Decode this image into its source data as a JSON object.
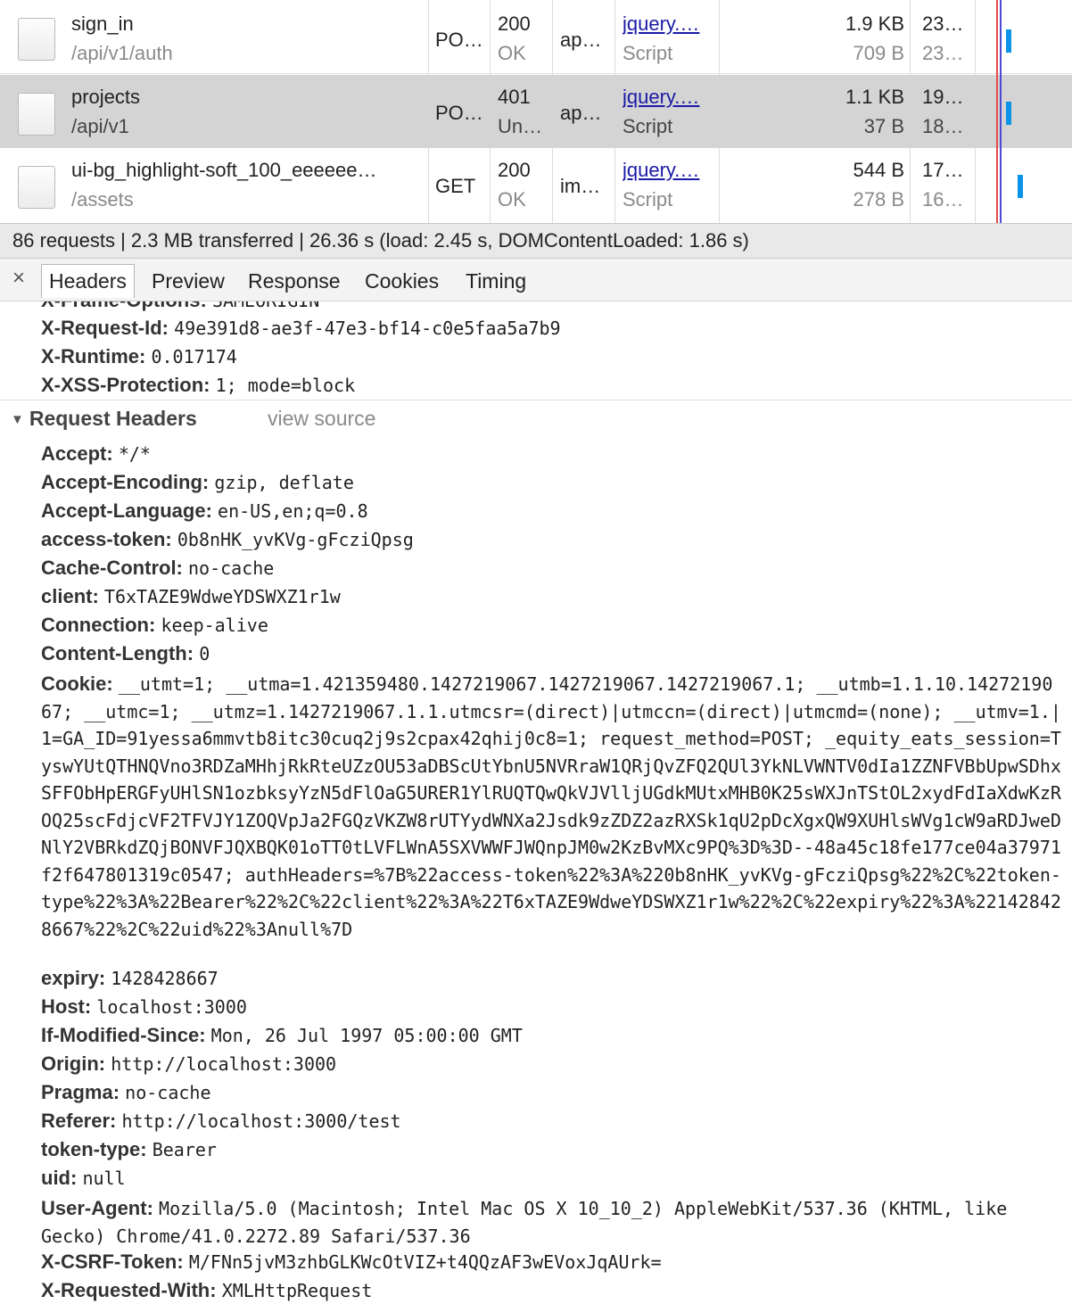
{
  "requests": [
    {
      "name": "sign_in",
      "path": "/api/v1/auth",
      "method": "PO…",
      "status": "200",
      "status_text": "OK",
      "type": "ap…",
      "initiator": "jquery.…",
      "initiator_type": "Script",
      "size": "1.9 KB",
      "content": "709 B",
      "time": "23…",
      "latency": "23…",
      "selected": false
    },
    {
      "name": "projects",
      "path": "/api/v1",
      "method": "PO…",
      "status": "401",
      "status_text": "Un…",
      "type": "ap…",
      "initiator": "jquery.…",
      "initiator_type": "Script",
      "size": "1.1 KB",
      "content": "37 B",
      "time": "19…",
      "latency": "18…",
      "selected": true
    },
    {
      "name": "ui-bg_highlight-soft_100_eeeeee…",
      "path": "/assets",
      "method": "GET",
      "status": "200",
      "status_text": "OK",
      "type": "im…",
      "initiator": "jquery.…",
      "initiator_type": "Script",
      "size": "544 B",
      "content": "278 B",
      "time": "17…",
      "latency": "16…",
      "selected": false
    }
  ],
  "status_bar": "86 requests | 2.3 MB transferred | 26.36 s (load: 2.45 s, DOMContentLoaded: 1.86 s)",
  "tabs": {
    "close": "×",
    "items": [
      "Headers",
      "Preview",
      "Response",
      "Cookies",
      "Timing"
    ],
    "active": "Headers"
  },
  "response_headers_tail": [
    {
      "k": "X-Frame-Options:",
      "v": "SAMEORIGIN"
    },
    {
      "k": "X-Request-Id:",
      "v": "49e391d8-ae3f-47e3-bf14-c0e5faa5a7b9"
    },
    {
      "k": "X-Runtime:",
      "v": "0.017174"
    },
    {
      "k": "X-XSS-Protection:",
      "v": "1; mode=block"
    }
  ],
  "request_section": {
    "title": "Request Headers",
    "view_source": "view source"
  },
  "request_headers_a": [
    {
      "k": "Accept:",
      "v": "*/*"
    },
    {
      "k": "Accept-Encoding:",
      "v": "gzip, deflate"
    },
    {
      "k": "Accept-Language:",
      "v": "en-US,en;q=0.8"
    },
    {
      "k": "access-token:",
      "v": "0b8nHK_yvKVg-gFcziQpsg"
    },
    {
      "k": "Cache-Control:",
      "v": "no-cache"
    },
    {
      "k": "client:",
      "v": "T6xTAZE9WdweYDSWXZ1r1w"
    },
    {
      "k": "Connection:",
      "v": "keep-alive"
    },
    {
      "k": "Content-Length:",
      "v": "0"
    }
  ],
  "cookie": {
    "k": "Cookie:",
    "v": "__utmt=1; __utma=1.421359480.1427219067.1427219067.1427219067.1; __utmb=1.1.10.1427219067; __utmc=1; __utmz=1.1427219067.1.1.utmcsr=(direct)|utmccn=(direct)|utmcmd=(none); __utmv=1.|1=GA_ID=91yessa6mmvtb8itc30cuq2j9s2cpax42qhij0c8=1; request_method=POST; _equity_eats_session=TyswYUtQTHNQVno3RDZaMHhjRkRteUZzOU53aDBScUtYbnU5NVRraW1QRjQvZFQ2QUl3YkNLVWNTV0dIa1ZZNFVBbUpwSDhxSFFObHpERGFyUHlSN1ozbksyYzN5dFlOaG5URER1YlRUQTQwQkVJVlljUGdkMUtxMHB0K25sWXJnTStOL2xydFdIaXdwKzROQ25scFdjcVF2TFVJY1ZOQVpJa2FGQzVKZW8rUTYydWNXa2Jsdk9zZDZ2azRXSk1qU2pDcXgxQW9XUHlsWVg1cW9aRDJweDNlY2VBRkdZQjBONVFJQXBQK01oTT0tLVFLWnA5SXVWWFJWQnpJM0w2KzBvMXc9PQ%3D%3D--48a45c18fe177ce04a37971f2f647801319c0547; authHeaders=%7B%22access-token%22%3A%220b8nHK_yvKVg-gFcziQpsg%22%2C%22token-type%22%3A%22Bearer%22%2C%22client%22%3A%22T6xTAZE9WdweYDSWXZ1r1w%22%2C%22expiry%22%3A%221428428667%22%2C%22uid%22%3Anull%7D"
  },
  "request_headers_b": [
    {
      "k": "expiry:",
      "v": "1428428667"
    },
    {
      "k": "Host:",
      "v": "localhost:3000"
    },
    {
      "k": "If-Modified-Since:",
      "v": "Mon, 26 Jul 1997 05:00:00 GMT"
    },
    {
      "k": "Origin:",
      "v": "http://localhost:3000"
    },
    {
      "k": "Pragma:",
      "v": "no-cache"
    },
    {
      "k": "Referer:",
      "v": "http://localhost:3000/test"
    },
    {
      "k": "token-type:",
      "v": "Bearer"
    },
    {
      "k": "uid:",
      "v": "null"
    }
  ],
  "user_agent": {
    "k": "User-Agent:",
    "v": "Mozilla/5.0 (Macintosh; Intel Mac OS X 10_10_2) AppleWebKit/537.36 (KHTML, like Gecko) Chrome/41.0.2272.89 Safari/537.36"
  },
  "request_headers_c": [
    {
      "k": "X-CSRF-Token:",
      "v": "M/FNn5jvM3zhbGLKWcOtVIZ+t4QQzAF3wEVoxJqAUrk="
    },
    {
      "k": "X-Requested-With:",
      "v": "XMLHttpRequest"
    }
  ],
  "colors": {
    "selected_row": "#d4d4d4",
    "link": "#1a1aa6",
    "timeline_bar": "#0a94e8",
    "load_line": "#e14c4c",
    "dom_line": "#4a4ad6"
  }
}
